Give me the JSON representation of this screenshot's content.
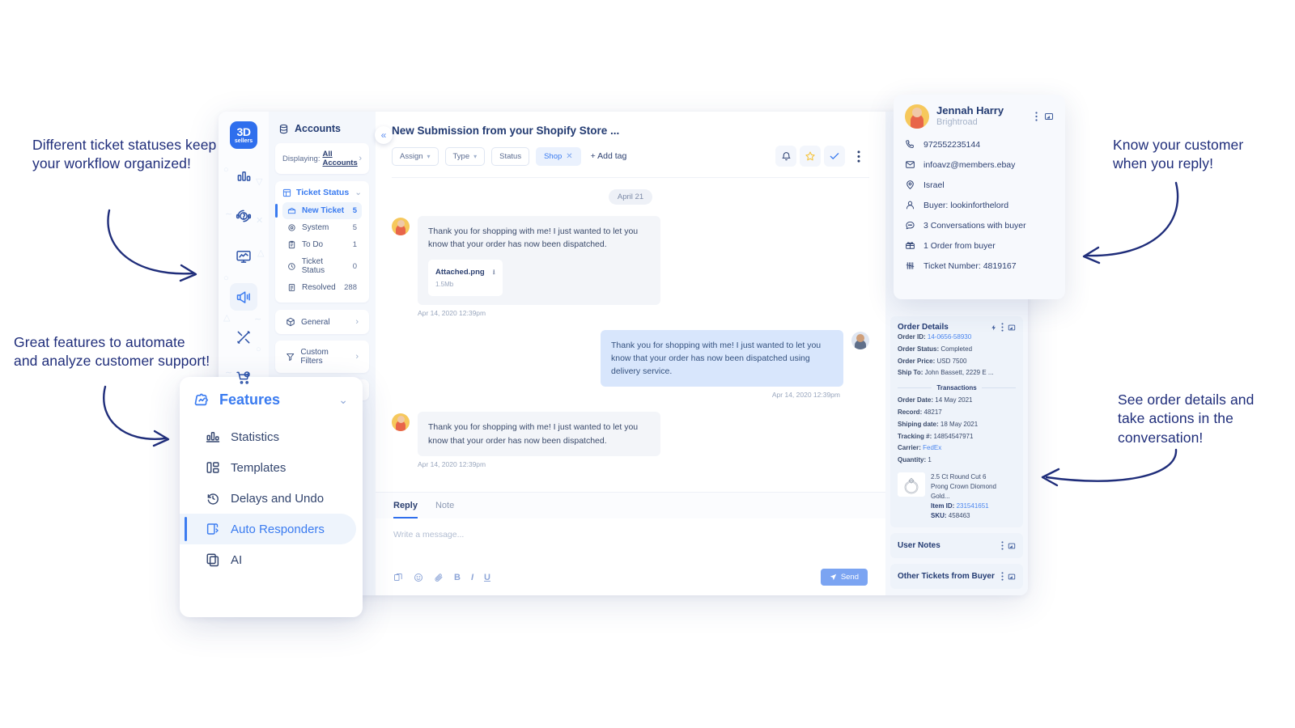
{
  "callouts": [
    {
      "id": "c1",
      "text": "Different ticket statuses keep\nyour workflow organized!"
    },
    {
      "id": "c2",
      "text": "Great features to automate\nand analyze customer support!"
    },
    {
      "id": "c3",
      "text": "Know your customer\nwhen you reply!"
    },
    {
      "id": "c4",
      "text": "See order details and\ntake actions in the\nconversation!"
    }
  ],
  "brand": {
    "line1": "3D",
    "line2": "sellers"
  },
  "rail": {
    "items": [
      {
        "icon": "bar-chart-icon",
        "active": false
      },
      {
        "icon": "support-headset-icon",
        "active": false
      },
      {
        "icon": "monitor-analytics-icon",
        "active": false
      },
      {
        "icon": "megaphone-icon",
        "active": true
      },
      {
        "icon": "crossed-tools-icon",
        "active": false
      },
      {
        "icon": "cart-check-icon",
        "active": false
      }
    ]
  },
  "sidebar": {
    "header": "Accounts",
    "displaying_label": "Displaying:",
    "displaying_value": "All Accounts",
    "group_title": "Ticket Status",
    "items": [
      {
        "label": "New Ticket",
        "count": "5",
        "icon": "new-ticket-icon",
        "active": true
      },
      {
        "label": "System",
        "count": "5",
        "icon": "gear-icon",
        "active": false
      },
      {
        "label": "To Do",
        "count": "1",
        "icon": "clipboard-icon",
        "active": false
      },
      {
        "label": "Ticket Status",
        "count": "0",
        "icon": "clock-icon",
        "active": false
      },
      {
        "label": "Resolved",
        "count": "288",
        "icon": "document-icon",
        "active": false
      }
    ],
    "rows": [
      {
        "label": "General",
        "icon": "cube-icon"
      },
      {
        "label": "Custom Filters",
        "icon": "funnel-icon"
      }
    ]
  },
  "conversation": {
    "title": "New Submission from your Shopify Store ...",
    "filters": [
      {
        "label": "Assign",
        "type": "dropdown"
      },
      {
        "label": "Type",
        "type": "dropdown"
      },
      {
        "label": "Status",
        "type": "plain"
      }
    ],
    "tag": "Shop",
    "add_tag": "+ Add tag",
    "actions": [
      {
        "icon": "bell-icon"
      },
      {
        "icon": "star-icon"
      },
      {
        "icon": "check-icon"
      },
      {
        "icon": "kebab-menu-icon"
      }
    ],
    "day_divider": "April 21",
    "messages": [
      {
        "direction": "in",
        "avatar": "female-avatar",
        "text": "Thank you for shopping with me! I just wanted to let you know that your order has now been dispatched.",
        "attachment": {
          "name": "Attached.png",
          "size": "1.5Mb"
        },
        "timestamp": "Apr 14, 2020 12:39pm"
      },
      {
        "direction": "out",
        "avatar": "male-avatar",
        "text": "Thank you for shopping with me! I just wanted to let you know that your order has now been dispatched using  delivery service.",
        "timestamp": "Apr 14, 2020 12:39pm"
      },
      {
        "direction": "in",
        "avatar": "female-avatar",
        "text": "Thank you for shopping with me! I just wanted to let you know that your order has now been dispatched.",
        "timestamp": "Apr 14, 2020 12:39pm"
      }
    ]
  },
  "composer": {
    "tabs": [
      {
        "label": "Reply",
        "active": true
      },
      {
        "label": "Note",
        "active": false
      }
    ],
    "placeholder": "Write a message...",
    "tools": [
      {
        "icon": "template-icon",
        "glyph": "❐"
      },
      {
        "icon": "emoji-icon",
        "glyph": "☺"
      },
      {
        "icon": "attachment-icon",
        "glyph": "📎"
      },
      {
        "icon": "bold-icon",
        "glyph": "B"
      },
      {
        "icon": "italic-icon",
        "glyph": "I"
      },
      {
        "icon": "underline-icon",
        "glyph": "U"
      }
    ],
    "send_label": "Send"
  },
  "customer": {
    "name": "Jennah Harry",
    "company": "Brightroad",
    "rows": [
      {
        "icon": "phone-icon",
        "text": "972552235144"
      },
      {
        "icon": "mail-icon",
        "text": "infoavz@members.ebay"
      },
      {
        "icon": "pin-icon",
        "text": "Israel"
      },
      {
        "icon": "user-icon",
        "text": "Buyer: lookinforthelord"
      },
      {
        "icon": "chat-icon",
        "text": "3 Conversations with buyer"
      },
      {
        "icon": "package-icon",
        "text": "1 Order from buyer"
      },
      {
        "icon": "tally-icon",
        "text": "Ticket Number: 4819167"
      }
    ]
  },
  "order": {
    "title": "Order Details",
    "fields": [
      {
        "key": "Order ID:",
        "value": "14-0656-58930",
        "link": true
      },
      {
        "key": "Order Status:",
        "value": "Completed",
        "link": false
      },
      {
        "key": "Order Price:",
        "value": "USD 7500",
        "link": false
      },
      {
        "key": "Ship To:",
        "value": "John Bassett, 2229 E ...",
        "link": false
      }
    ],
    "divider": "Transactions",
    "transactions": [
      {
        "key": "Order Date:",
        "value": "14 May 2021",
        "link": false
      },
      {
        "key": "Record:",
        "value": "48217",
        "link": false
      },
      {
        "key": "Shiping date:",
        "value": "18 May 2021",
        "link": false
      },
      {
        "key": "Tracking #:",
        "value": "14854547971",
        "link": false
      },
      {
        "key": "Carrier:",
        "value": "FedEx",
        "link": true
      },
      {
        "key": "Quantity:",
        "value": "1",
        "link": false
      }
    ],
    "product": {
      "title_line1": "2.5 Ct Round Cut 6",
      "title_line2": "Prong Crown Diomond Gold...",
      "item_id_key": "Item ID:",
      "item_id_value": "231541651",
      "sku_key": "SKU:",
      "sku_value": "458463"
    }
  },
  "user_notes": {
    "title": "User Notes"
  },
  "other_tickets": {
    "title": "Other Tickets from Buyer"
  },
  "features": {
    "title": "Features",
    "items": [
      {
        "label": "Statistics",
        "icon": "statistics-icon",
        "active": false
      },
      {
        "label": "Templates",
        "icon": "templates-icon",
        "active": false
      },
      {
        "label": "Delays and Undo",
        "icon": "undo-clock-icon",
        "active": false
      },
      {
        "label": "Auto Responders",
        "icon": "auto-responders-icon",
        "active": true
      },
      {
        "label": "AI",
        "icon": "ai-copy-icon",
        "active": false
      }
    ]
  },
  "colors": {
    "accent": "#3a7bf0",
    "ink": "#233b72",
    "callout": "#1f2d7a",
    "bubble_in": "#f3f5f9",
    "bubble_out": "#d8e6fc",
    "star": "#f5c542",
    "panel": "#f4f7fc"
  }
}
